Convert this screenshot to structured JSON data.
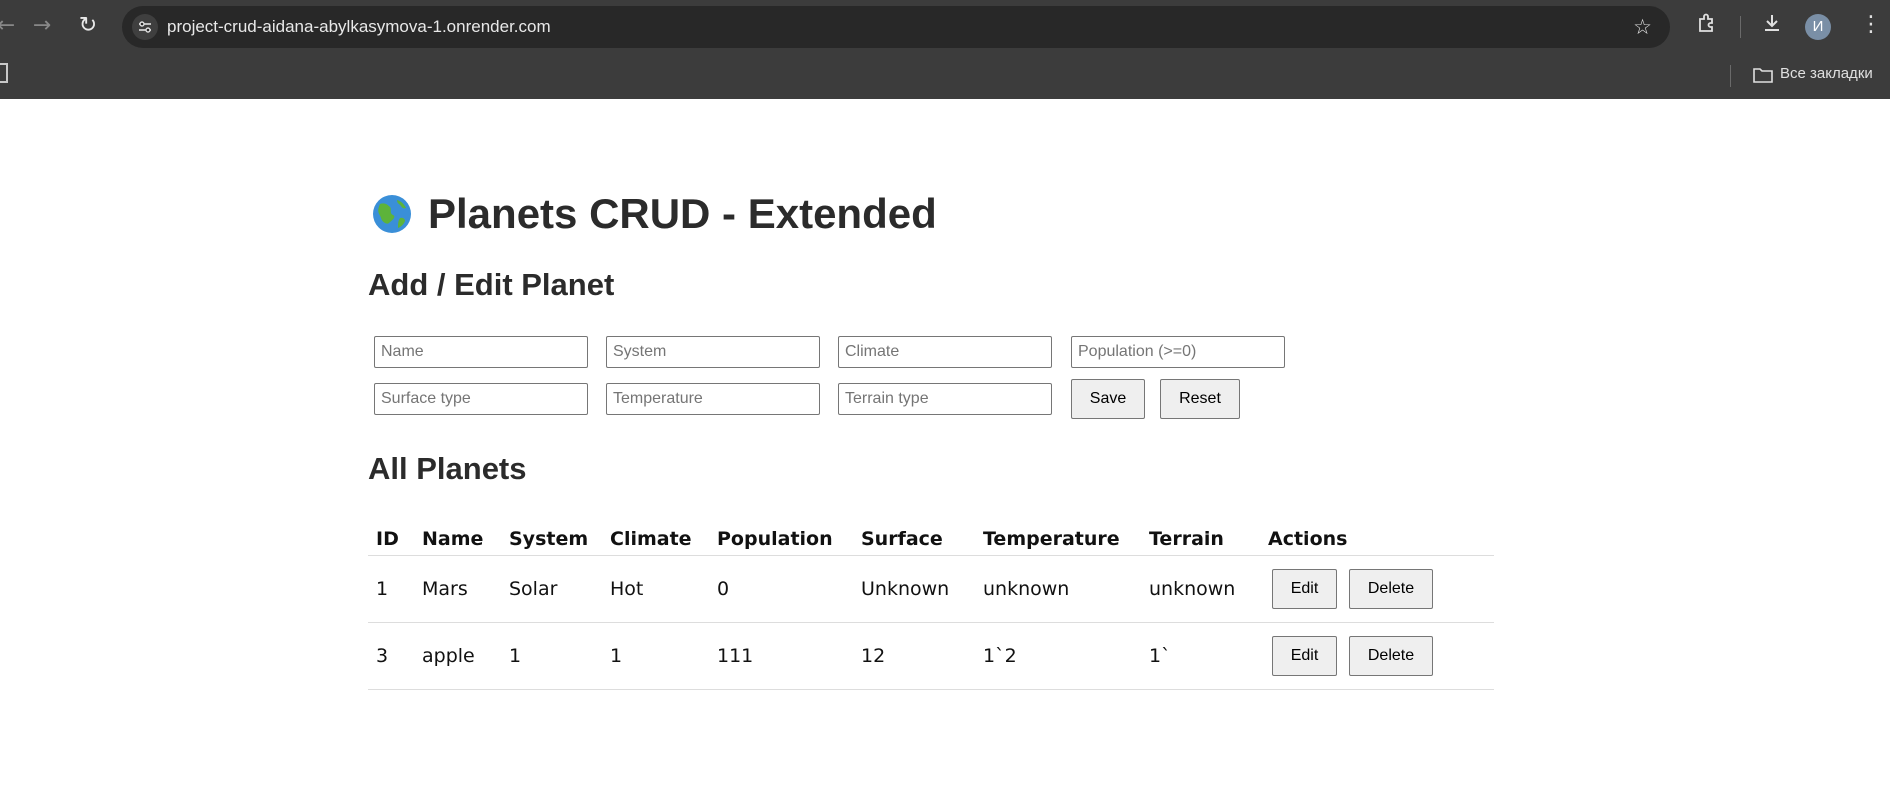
{
  "browser": {
    "url": "project-crud-aidana-abylkasymova-1.onrender.com",
    "profile_initial": "И",
    "bookmarks_label": "Все закладки",
    "icons": [
      "back-arrow-icon",
      "forward-arrow-icon",
      "reload-icon",
      "site-info-icon",
      "star-icon",
      "extensions-icon",
      "download-icon",
      "folder-icon"
    ]
  },
  "page": {
    "title": "Planets CRUD - Extended",
    "title_icon": "globe-icon",
    "form_heading": "Add / Edit Planet",
    "list_heading": "All Planets"
  },
  "form": {
    "name_placeholder": "Name",
    "system_placeholder": "System",
    "climate_placeholder": "Climate",
    "population_placeholder": "Population (>=0)",
    "surface_placeholder": "Surface type",
    "temperature_placeholder": "Temperature",
    "terrain_placeholder": "Terrain type",
    "save_label": "Save",
    "reset_label": "Reset"
  },
  "table": {
    "headers": {
      "id": "ID",
      "name": "Name",
      "system": "System",
      "climate": "Climate",
      "population": "Population",
      "surface": "Surface",
      "temperature": "Temperature",
      "terrain": "Terrain",
      "actions": "Actions"
    },
    "rows": [
      {
        "id": "1",
        "name": "Mars",
        "system": "Solar",
        "climate": "Hot",
        "population": "0",
        "surface": "Unknown",
        "temperature": "unknown",
        "terrain": "unknown",
        "edit_label": "Edit",
        "delete_label": "Delete"
      },
      {
        "id": "3",
        "name": "apple",
        "system": "1",
        "climate": "1",
        "population": "111",
        "surface": "12",
        "temperature": "1`2",
        "terrain": "1`",
        "edit_label": "Edit",
        "delete_label": "Delete"
      }
    ]
  }
}
